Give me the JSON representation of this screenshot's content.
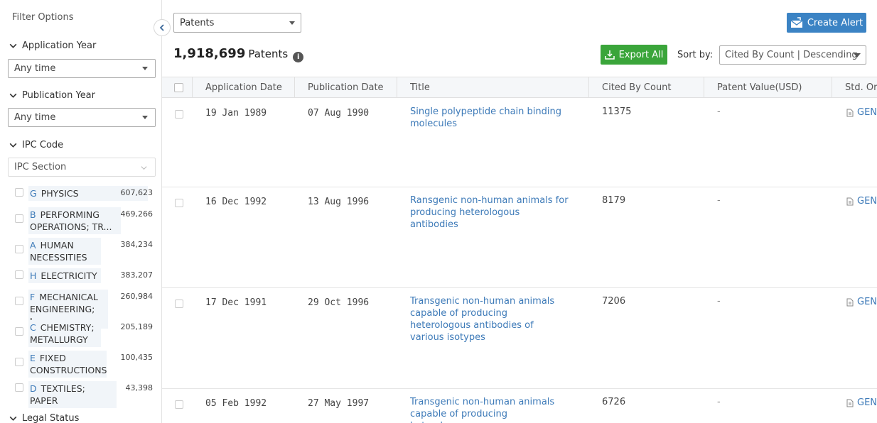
{
  "sidebar": {
    "title": "Filter Options",
    "sections": {
      "application_year": {
        "label": "Application Year",
        "value": "Any time"
      },
      "publication_year": {
        "label": "Publication Year",
        "value": "Any time"
      },
      "ipc_code": {
        "label": "IPC Code",
        "placeholder": "IPC Section"
      },
      "legal_status": {
        "label": "Legal Status"
      }
    },
    "ipc_items": [
      {
        "code": "G",
        "name": "PHYSICS",
        "count": "607,623"
      },
      {
        "code": "B",
        "name": "PERFORMING",
        "name2": "OPERATIONS; TR...",
        "count": "469,266"
      },
      {
        "code": "A",
        "name": "HUMAN",
        "name2": "NECESSITIES",
        "count": "384,234"
      },
      {
        "code": "H",
        "name": "ELECTRICITY",
        "count": "383,207"
      },
      {
        "code": "F",
        "name": "MECHANICAL",
        "name2": "ENGINEERING; L...",
        "count": "260,984"
      },
      {
        "code": "C",
        "name": "CHEMISTRY;",
        "name2": "METALLURGY",
        "count": "205,189"
      },
      {
        "code": "E",
        "name": "FIXED",
        "name2": "CONSTRUCTIONS",
        "count": "100,435"
      },
      {
        "code": "D",
        "name": "TEXTILES; PAPER",
        "count": "43,398"
      }
    ]
  },
  "toolbar": {
    "type_select": "Patents",
    "create_alert": "Create Alert",
    "result_count": "1,918,699",
    "result_unit": "Patents",
    "export_all": "Export All",
    "sort_label": "Sort by:",
    "sort_value": "Cited By Count | Descending"
  },
  "table": {
    "headers": [
      "Application Date",
      "Publication Date",
      "Title",
      "Cited By Count",
      "Patent Value(USD)",
      "Std. Ori"
    ],
    "rows": [
      {
        "app_date": "19 Jan 1989",
        "pub_date": "07 Aug 1990",
        "title": "Single polypeptide chain binding molecules",
        "cited": "11375",
        "value": "-",
        "std": "GEN"
      },
      {
        "app_date": "16 Dec 1992",
        "pub_date": "13 Aug 1996",
        "title": "Ransgenic non-human animals for producing heterologous antibodies",
        "cited": "8179",
        "value": "-",
        "std": "GEN"
      },
      {
        "app_date": "17 Dec 1991",
        "pub_date": "29 Oct 1996",
        "title": "Transgenic non-human animals capable of producing heterologous antibodies of various isotypes",
        "cited": "7206",
        "value": "-",
        "std": "GEN"
      },
      {
        "app_date": "05 Feb 1992",
        "pub_date": "27 May 1997",
        "title": "Transgenic non-human animals capable of producing heterologous",
        "cited": "6726",
        "value": "-",
        "std": "GEN"
      }
    ]
  },
  "colors": {
    "accent": "#3b83c4",
    "export_green": "#3aa53a",
    "link": "#3d7ab8"
  }
}
